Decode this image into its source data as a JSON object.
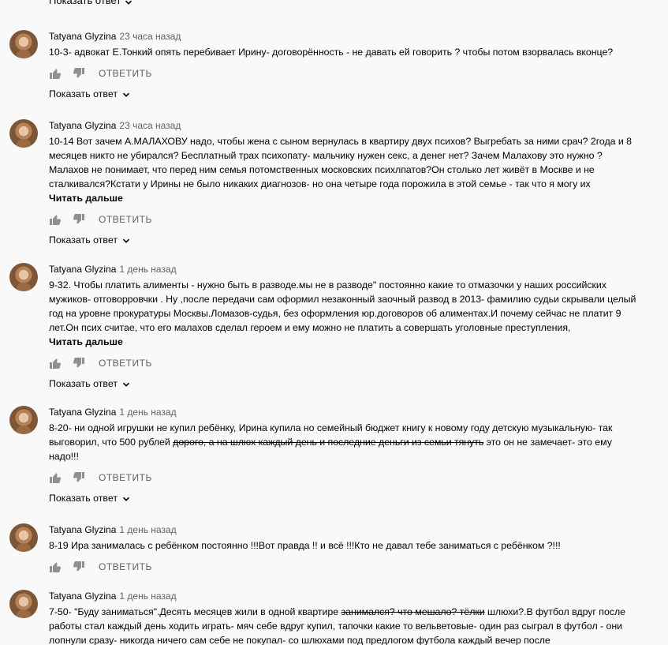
{
  "top_stub": {
    "label": "Показать ответ"
  },
  "ui": {
    "reply": "ОТВЕТИТЬ",
    "read_more": "Читать дальше",
    "show_reply": "Показать ответ"
  },
  "comments": [
    {
      "author": "Tatyana Glyzina",
      "time": "23 часа назад",
      "text": "10-3- адвокат Е.Тонкий опять перебивает Ирину- договорённость - не давать ей говорить ? чтобы потом взорвалась вконце?"
    },
    {
      "author": "Tatyana Glyzina",
      "time": "23 часа назад",
      "text": "10-14 Вот зачем А.МАЛАХОВУ надо, чтобы жена с сыном вернулась в квартиру двух психов? Выгребать за ними срач? 2года и 8 месяцев никто не убирался? Бесплатный трах психопату- мальчику нужен секс, а денег нет? Зачем  Малахову это нужно ? Малахов не понимает, что перед ним семья потомственных московских психлпатов?Он столько лет живёт в Москве и не сталкивался?Кстати у Ирины не было никаких диагнозов- но она четыре года порожила в этой семье - так что я могу их"
    },
    {
      "author": "Tatyana Glyzina",
      "time": "1 день назад",
      "text": "9-32. Чтобы платить алименты - нужно быть в разводе.мы не в разводе\" постоянно какие то отмазочки у наших российских мужиков- отговорровчки . Ну ,после передачи сам оформил незаконный заочный  развод в 2013- фамилию судьи скрывали целый год на уровне прокуратуры Москвы.Ломазов-судья, без оформления юр.договоров об алиментах.И почему сейчас не платит 9 лет.Он псих считае, что его малахов сделал героем и ему можно не платить а совершать уголовные преступления,"
    },
    {
      "author": "Tatyana Glyzina",
      "time": "1 день назад",
      "text_a": "8-20- ни одной игрушки не купил ребёнку, Ирина купила но семейный бюджет книгу к новому году детскую музыкальную- так выговорил, что 500 рублей ",
      "text_strike": "дорого, а на шлюх каждый день и последние деньги из семьи тянуть",
      "text_b": " это он не замечает- это ему надо!!!"
    },
    {
      "author": "Tatyana Glyzina",
      "time": "1 день назад",
      "text": "8-19 Ира занималась с ребёнком постоянно !!!Вот правда !! и всё !!!Кто не давал тебе заниматься с ребёнком ?!!!"
    },
    {
      "author": "Tatyana Glyzina",
      "time": "1 день назад",
      "text_a": "7-50- \"Буду заниматься\".Десять месяцев жили в одной квартире ",
      "text_strike": "занимался? что мешало? тёлки",
      "text_b": " шлюхи?.В футбол вдруг после работы стал каждый день ходить играть- мяч себе вдруг купил, тапочки какие то вельветовые- один раз сыграл в футбол - они лопнули сразу- никогда ничего сам себе не покупал- со шлюхами под предлогом футбола каждый вечер после"
    }
  ]
}
